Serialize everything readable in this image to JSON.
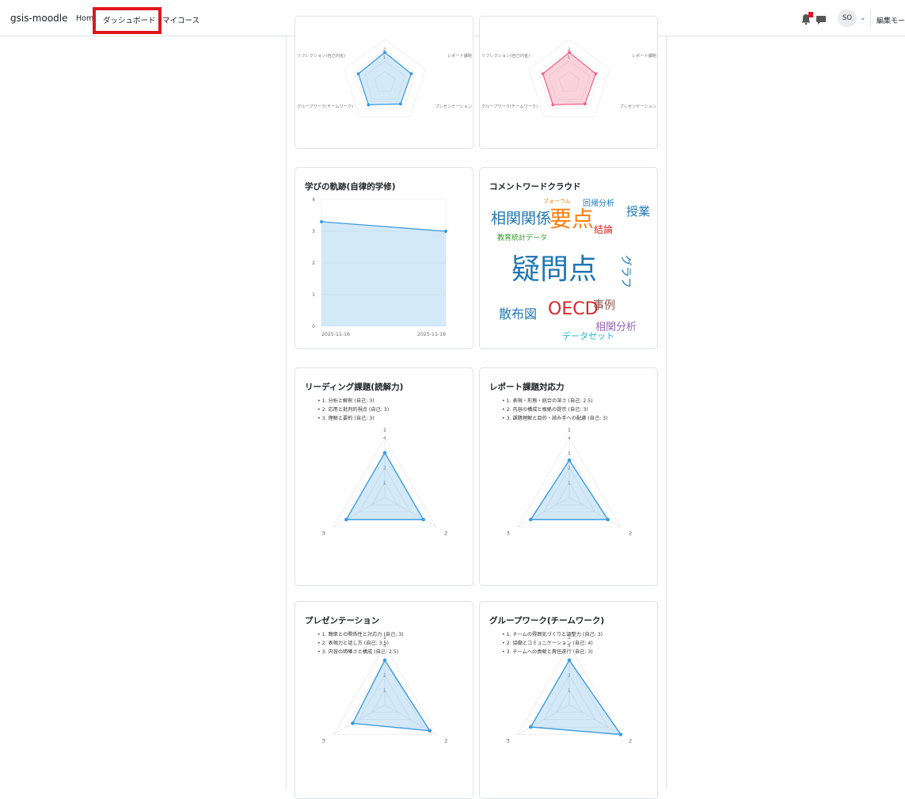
{
  "nav": {
    "brand": "gsis-moodle",
    "home": "Home",
    "dashboard": "ダッシュボード",
    "mycourses": "マイコース",
    "avatar": "SO",
    "edit_mode": "編集モード"
  },
  "top_radars": {
    "axis_labels": [
      "リフレクション(自己内省)",
      "レポート課題",
      "プレゼンテーション",
      "グループワーク(チームワーク)"
    ],
    "left_color": "#3b9de0",
    "right_color": "#f06a8a"
  },
  "learning_trail": {
    "title": "学びの軌跡(自律的学修)",
    "chart_data": {
      "type": "area",
      "x": [
        "2025-11-16",
        "2025-11-19"
      ],
      "values": [
        3.3,
        3.0
      ],
      "ylim": [
        0,
        4
      ],
      "yticks": [
        "0",
        "1",
        "2",
        "3",
        "4"
      ]
    }
  },
  "word_cloud": {
    "title": "コメントワードクラウド",
    "words": [
      "相関関係",
      "要点",
      "疑問点",
      "OECD",
      "散布図",
      "授業",
      "結論",
      "事例",
      "相関分析",
      "データセット",
      "教育統計データ",
      "回帰分析",
      "フォーラム",
      "グラフ"
    ]
  },
  "reading": {
    "title": "リーディング課題(読解力)",
    "criteria": [
      "1. 分析と解釈 (自己: 3)",
      "2. 応用と批判的視点 (自己: 3)",
      "3. 理解と要約 (自己: 3)"
    ],
    "chart_data": {
      "type": "radar",
      "axes": [
        "1",
        "2",
        "3"
      ],
      "values": [
        3,
        3,
        3
      ],
      "max": 4,
      "ticks": [
        "1",
        "2",
        "3",
        "4"
      ]
    }
  },
  "report": {
    "title": "レポート課題対応力",
    "criteria": [
      "1. 表現・形態・統合の深さ (自己: 2.5)",
      "2. 内容の構成と根拠の提示 (自己: 3)",
      "3. 課題理解と目的・読み手への配慮 (自己: 3)"
    ],
    "chart_data": {
      "type": "radar",
      "axes": [
        "1",
        "2",
        "3"
      ],
      "values": [
        2.5,
        3,
        3
      ],
      "max": 4,
      "ticks": [
        "1",
        "2",
        "3",
        "4"
      ]
    }
  },
  "presentation": {
    "title": "プレゼンテーション",
    "criteria": [
      "1. 聴衆との関係性と対応力 (自己: 3)",
      "2. 表現力と話し方 (自己: 3.5)",
      "3. 内容の明確さと構成 (自己: 2.5)"
    ],
    "chart_data": {
      "type": "radar",
      "axes": [
        "1",
        "2",
        "3"
      ],
      "values": [
        3,
        3.5,
        2.5
      ],
      "max": 4,
      "ticks": [
        "1",
        "2",
        "3",
        "4"
      ]
    }
  },
  "groupwork": {
    "title": "グループワーク(チームワーク)",
    "criteria": [
      "1. チームの雰囲気づくりと調整力 (自己: 3)",
      "2. 協働とコミュニケーション (自己: 4)",
      "3. チームへの貢献と責任遂行 (自己: 3)"
    ],
    "chart_data": {
      "type": "radar",
      "axes": [
        "1",
        "2",
        "3"
      ],
      "values": [
        3,
        4,
        3
      ],
      "max": 4,
      "ticks": [
        "1",
        "2",
        "3",
        "4"
      ]
    }
  }
}
